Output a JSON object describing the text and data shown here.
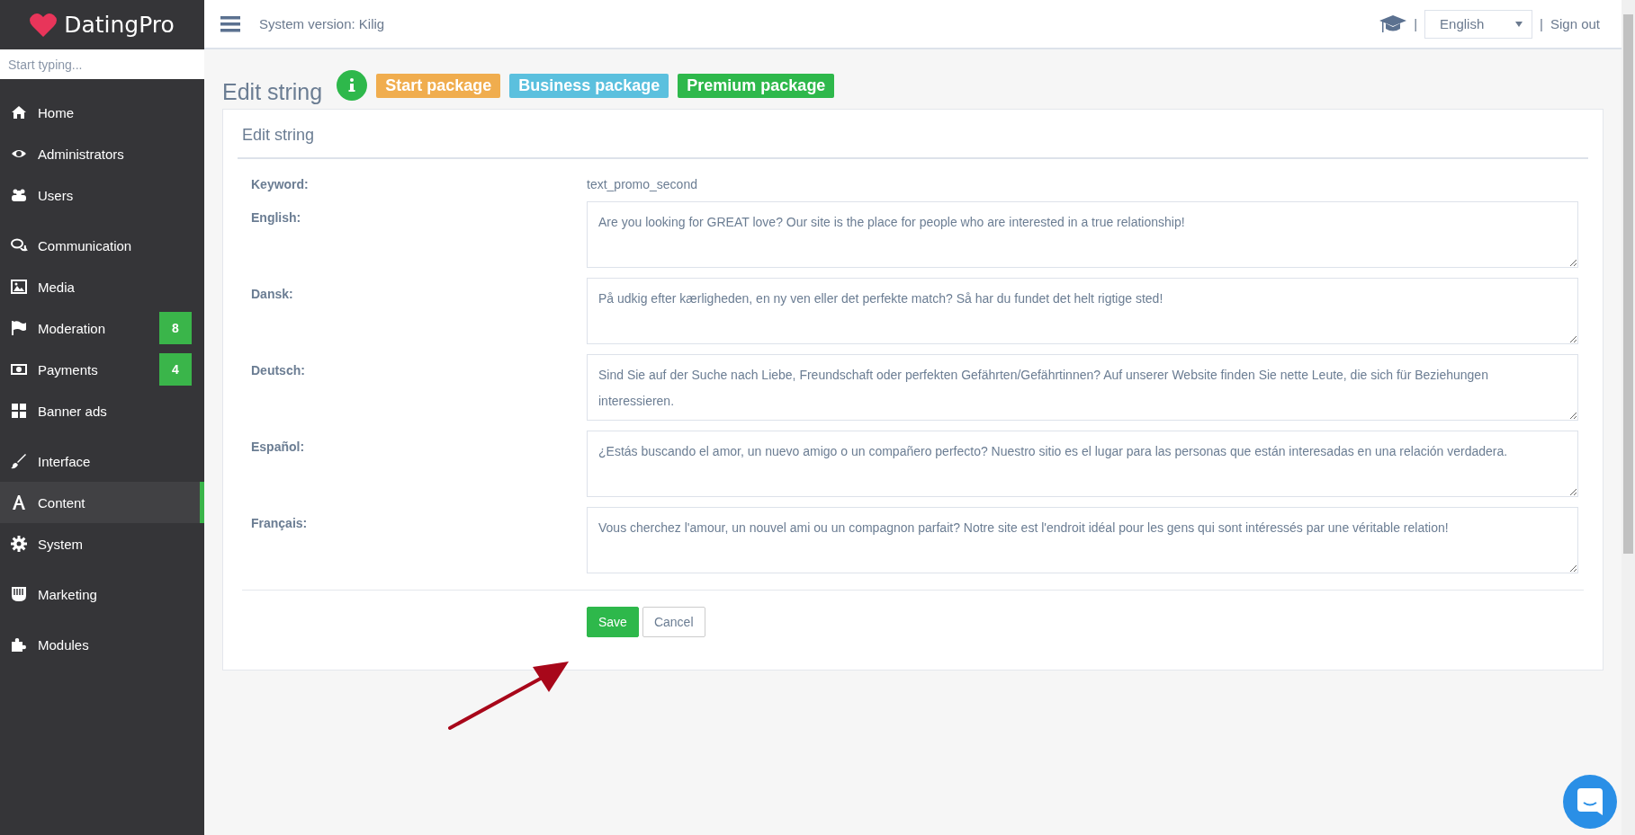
{
  "brand": {
    "logo": "DatingPro"
  },
  "sidebar": {
    "search_placeholder": "Start typing...",
    "groups": [
      {
        "items": [
          {
            "label": "Home",
            "selected": false
          },
          {
            "label": "Administrators",
            "selected": false
          },
          {
            "label": "Users",
            "selected": false
          }
        ]
      },
      {
        "items": [
          {
            "label": "Communication",
            "selected": false
          },
          {
            "label": "Media",
            "selected": false
          },
          {
            "label": "Moderation",
            "selected": false,
            "badge": "8"
          },
          {
            "label": "Payments",
            "selected": false,
            "badge": "4"
          },
          {
            "label": "Banner ads",
            "selected": false
          }
        ]
      },
      {
        "items": [
          {
            "label": "Interface",
            "selected": false
          },
          {
            "label": "Content",
            "selected": true
          },
          {
            "label": "System",
            "selected": false
          }
        ]
      },
      {
        "items": [
          {
            "label": "Marketing",
            "selected": false
          }
        ]
      },
      {
        "items": [
          {
            "label": "Modules",
            "selected": false
          }
        ]
      }
    ]
  },
  "header": {
    "system_version": "System version: Kilig",
    "separators": [
      "|",
      "|"
    ],
    "language": "English",
    "sign_out": "Sign out"
  },
  "page": {
    "title": "Edit string",
    "packages": [
      {
        "label": "Start package",
        "color": "#f0ad4e"
      },
      {
        "label": "Business package",
        "color": "#5bc0de"
      },
      {
        "label": "Premium package",
        "color": "#2eb84b"
      }
    ]
  },
  "form": {
    "title": "Edit string",
    "keyword_label": "Keyword:",
    "keyword_value": "text_promo_second",
    "translations": [
      {
        "label": "English:",
        "value": "Are you looking for GREAT love? Our site is the place for people who are interested in a true relationship!"
      },
      {
        "label": "Dansk:",
        "value": "På udkig efter kærligheden, en ny ven eller det perfekte match? Så har du fundet det helt rigtige sted!"
      },
      {
        "label": "Deutsch:",
        "value": "Sind Sie auf der Suche nach Liebe, Freundschaft oder perfekten Gefährten/Gefährtinnen? Auf unserer Website finden Sie nette Leute, die sich für Beziehungen interessieren."
      },
      {
        "label": "Español:",
        "value": "¿Estás buscando el amor, un nuevo amigo o un compañero perfecto? Nuestro sitio es el lugar para las personas que están interesadas en una relación verdadera."
      },
      {
        "label": "Français:",
        "value": "Vous cherchez l'amour, un nouvel ami ou un compagnon parfait? Notre site est l'endroit idéal pour les gens qui sont intéressés par une véritable relation!"
      }
    ],
    "save": "Save",
    "cancel": "Cancel"
  }
}
